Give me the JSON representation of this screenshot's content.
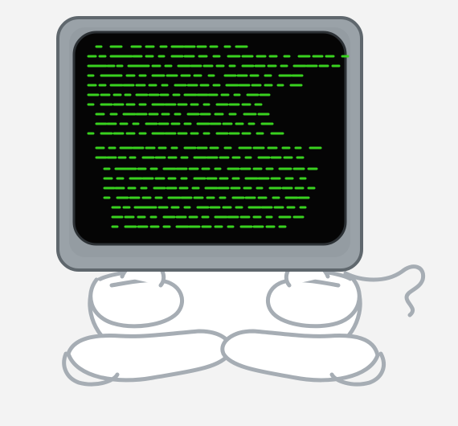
{
  "illustration": {
    "subject": "computer-monitor-head-character-sitting",
    "colors": {
      "background": "#f3f3f3",
      "outline": "#a6adb4",
      "body_fill": "#ffffff",
      "monitor_frame": "#9aa2a8",
      "monitor_frame_edge": "#5f676d",
      "screen": "#050505",
      "code_text": "#39d11f"
    },
    "elements": [
      "monitor-head",
      "terminal-screen",
      "green-code-lines",
      "crossed-arms",
      "crossed-legs",
      "sigh-puff"
    ]
  }
}
